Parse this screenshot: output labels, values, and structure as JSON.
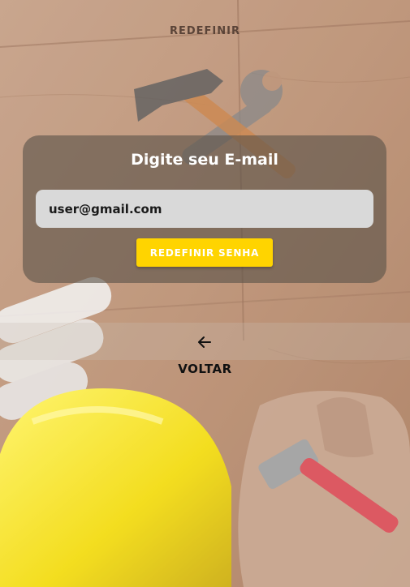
{
  "header": {
    "title": "REDEFINIR"
  },
  "card": {
    "title": "Digite seu E-mail",
    "email_value": "user@gmail.com",
    "reset_button_label": "REDEFINIR SENHA"
  },
  "back": {
    "icon": "arrow-left-icon",
    "label": "VOLTAR"
  },
  "colors": {
    "accent_button": "#ffd400",
    "card_overlay": "#5a5248",
    "input_background": "#d9d9d9"
  }
}
